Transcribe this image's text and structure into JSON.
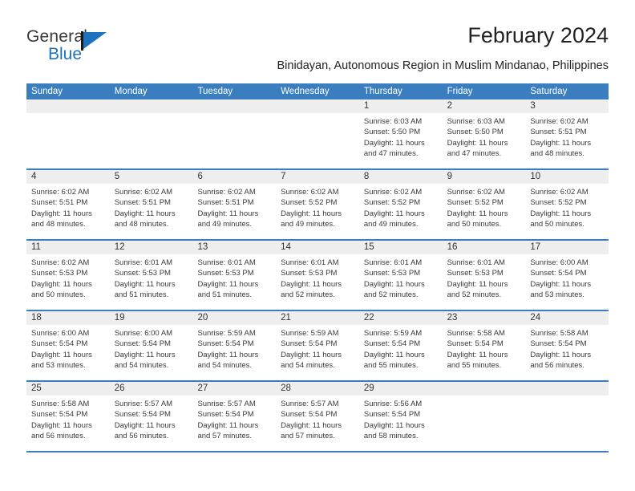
{
  "brand": {
    "name_part1": "General",
    "name_part2": "Blue",
    "flag_icon": "flag-icon"
  },
  "header": {
    "month_title": "February 2024",
    "location": "Binidayan, Autonomous Region in Muslim Mindanao, Philippines"
  },
  "calendar": {
    "weekdays": [
      "Sunday",
      "Monday",
      "Tuesday",
      "Wednesday",
      "Thursday",
      "Friday",
      "Saturday"
    ],
    "header_color": "#3A7EC0",
    "daynum_band_color": "#EEEEEE",
    "weeks": [
      [
        {
          "day": "",
          "sunrise": "",
          "sunset": "",
          "daylight_l1": "",
          "daylight_l2": ""
        },
        {
          "day": "",
          "sunrise": "",
          "sunset": "",
          "daylight_l1": "",
          "daylight_l2": ""
        },
        {
          "day": "",
          "sunrise": "",
          "sunset": "",
          "daylight_l1": "",
          "daylight_l2": ""
        },
        {
          "day": "",
          "sunrise": "",
          "sunset": "",
          "daylight_l1": "",
          "daylight_l2": ""
        },
        {
          "day": "1",
          "sunrise": "Sunrise: 6:03 AM",
          "sunset": "Sunset: 5:50 PM",
          "daylight_l1": "Daylight: 11 hours",
          "daylight_l2": "and 47 minutes."
        },
        {
          "day": "2",
          "sunrise": "Sunrise: 6:03 AM",
          "sunset": "Sunset: 5:50 PM",
          "daylight_l1": "Daylight: 11 hours",
          "daylight_l2": "and 47 minutes."
        },
        {
          "day": "3",
          "sunrise": "Sunrise: 6:02 AM",
          "sunset": "Sunset: 5:51 PM",
          "daylight_l1": "Daylight: 11 hours",
          "daylight_l2": "and 48 minutes."
        }
      ],
      [
        {
          "day": "4",
          "sunrise": "Sunrise: 6:02 AM",
          "sunset": "Sunset: 5:51 PM",
          "daylight_l1": "Daylight: 11 hours",
          "daylight_l2": "and 48 minutes."
        },
        {
          "day": "5",
          "sunrise": "Sunrise: 6:02 AM",
          "sunset": "Sunset: 5:51 PM",
          "daylight_l1": "Daylight: 11 hours",
          "daylight_l2": "and 48 minutes."
        },
        {
          "day": "6",
          "sunrise": "Sunrise: 6:02 AM",
          "sunset": "Sunset: 5:51 PM",
          "daylight_l1": "Daylight: 11 hours",
          "daylight_l2": "and 49 minutes."
        },
        {
          "day": "7",
          "sunrise": "Sunrise: 6:02 AM",
          "sunset": "Sunset: 5:52 PM",
          "daylight_l1": "Daylight: 11 hours",
          "daylight_l2": "and 49 minutes."
        },
        {
          "day": "8",
          "sunrise": "Sunrise: 6:02 AM",
          "sunset": "Sunset: 5:52 PM",
          "daylight_l1": "Daylight: 11 hours",
          "daylight_l2": "and 49 minutes."
        },
        {
          "day": "9",
          "sunrise": "Sunrise: 6:02 AM",
          "sunset": "Sunset: 5:52 PM",
          "daylight_l1": "Daylight: 11 hours",
          "daylight_l2": "and 50 minutes."
        },
        {
          "day": "10",
          "sunrise": "Sunrise: 6:02 AM",
          "sunset": "Sunset: 5:52 PM",
          "daylight_l1": "Daylight: 11 hours",
          "daylight_l2": "and 50 minutes."
        }
      ],
      [
        {
          "day": "11",
          "sunrise": "Sunrise: 6:02 AM",
          "sunset": "Sunset: 5:53 PM",
          "daylight_l1": "Daylight: 11 hours",
          "daylight_l2": "and 50 minutes."
        },
        {
          "day": "12",
          "sunrise": "Sunrise: 6:01 AM",
          "sunset": "Sunset: 5:53 PM",
          "daylight_l1": "Daylight: 11 hours",
          "daylight_l2": "and 51 minutes."
        },
        {
          "day": "13",
          "sunrise": "Sunrise: 6:01 AM",
          "sunset": "Sunset: 5:53 PM",
          "daylight_l1": "Daylight: 11 hours",
          "daylight_l2": "and 51 minutes."
        },
        {
          "day": "14",
          "sunrise": "Sunrise: 6:01 AM",
          "sunset": "Sunset: 5:53 PM",
          "daylight_l1": "Daylight: 11 hours",
          "daylight_l2": "and 52 minutes."
        },
        {
          "day": "15",
          "sunrise": "Sunrise: 6:01 AM",
          "sunset": "Sunset: 5:53 PM",
          "daylight_l1": "Daylight: 11 hours",
          "daylight_l2": "and 52 minutes."
        },
        {
          "day": "16",
          "sunrise": "Sunrise: 6:01 AM",
          "sunset": "Sunset: 5:53 PM",
          "daylight_l1": "Daylight: 11 hours",
          "daylight_l2": "and 52 minutes."
        },
        {
          "day": "17",
          "sunrise": "Sunrise: 6:00 AM",
          "sunset": "Sunset: 5:54 PM",
          "daylight_l1": "Daylight: 11 hours",
          "daylight_l2": "and 53 minutes."
        }
      ],
      [
        {
          "day": "18",
          "sunrise": "Sunrise: 6:00 AM",
          "sunset": "Sunset: 5:54 PM",
          "daylight_l1": "Daylight: 11 hours",
          "daylight_l2": "and 53 minutes."
        },
        {
          "day": "19",
          "sunrise": "Sunrise: 6:00 AM",
          "sunset": "Sunset: 5:54 PM",
          "daylight_l1": "Daylight: 11 hours",
          "daylight_l2": "and 54 minutes."
        },
        {
          "day": "20",
          "sunrise": "Sunrise: 5:59 AM",
          "sunset": "Sunset: 5:54 PM",
          "daylight_l1": "Daylight: 11 hours",
          "daylight_l2": "and 54 minutes."
        },
        {
          "day": "21",
          "sunrise": "Sunrise: 5:59 AM",
          "sunset": "Sunset: 5:54 PM",
          "daylight_l1": "Daylight: 11 hours",
          "daylight_l2": "and 54 minutes."
        },
        {
          "day": "22",
          "sunrise": "Sunrise: 5:59 AM",
          "sunset": "Sunset: 5:54 PM",
          "daylight_l1": "Daylight: 11 hours",
          "daylight_l2": "and 55 minutes."
        },
        {
          "day": "23",
          "sunrise": "Sunrise: 5:58 AM",
          "sunset": "Sunset: 5:54 PM",
          "daylight_l1": "Daylight: 11 hours",
          "daylight_l2": "and 55 minutes."
        },
        {
          "day": "24",
          "sunrise": "Sunrise: 5:58 AM",
          "sunset": "Sunset: 5:54 PM",
          "daylight_l1": "Daylight: 11 hours",
          "daylight_l2": "and 56 minutes."
        }
      ],
      [
        {
          "day": "25",
          "sunrise": "Sunrise: 5:58 AM",
          "sunset": "Sunset: 5:54 PM",
          "daylight_l1": "Daylight: 11 hours",
          "daylight_l2": "and 56 minutes."
        },
        {
          "day": "26",
          "sunrise": "Sunrise: 5:57 AM",
          "sunset": "Sunset: 5:54 PM",
          "daylight_l1": "Daylight: 11 hours",
          "daylight_l2": "and 56 minutes."
        },
        {
          "day": "27",
          "sunrise": "Sunrise: 5:57 AM",
          "sunset": "Sunset: 5:54 PM",
          "daylight_l1": "Daylight: 11 hours",
          "daylight_l2": "and 57 minutes."
        },
        {
          "day": "28",
          "sunrise": "Sunrise: 5:57 AM",
          "sunset": "Sunset: 5:54 PM",
          "daylight_l1": "Daylight: 11 hours",
          "daylight_l2": "and 57 minutes."
        },
        {
          "day": "29",
          "sunrise": "Sunrise: 5:56 AM",
          "sunset": "Sunset: 5:54 PM",
          "daylight_l1": "Daylight: 11 hours",
          "daylight_l2": "and 58 minutes."
        },
        {
          "day": "",
          "sunrise": "",
          "sunset": "",
          "daylight_l1": "",
          "daylight_l2": ""
        },
        {
          "day": "",
          "sunrise": "",
          "sunset": "",
          "daylight_l1": "",
          "daylight_l2": ""
        }
      ]
    ]
  }
}
